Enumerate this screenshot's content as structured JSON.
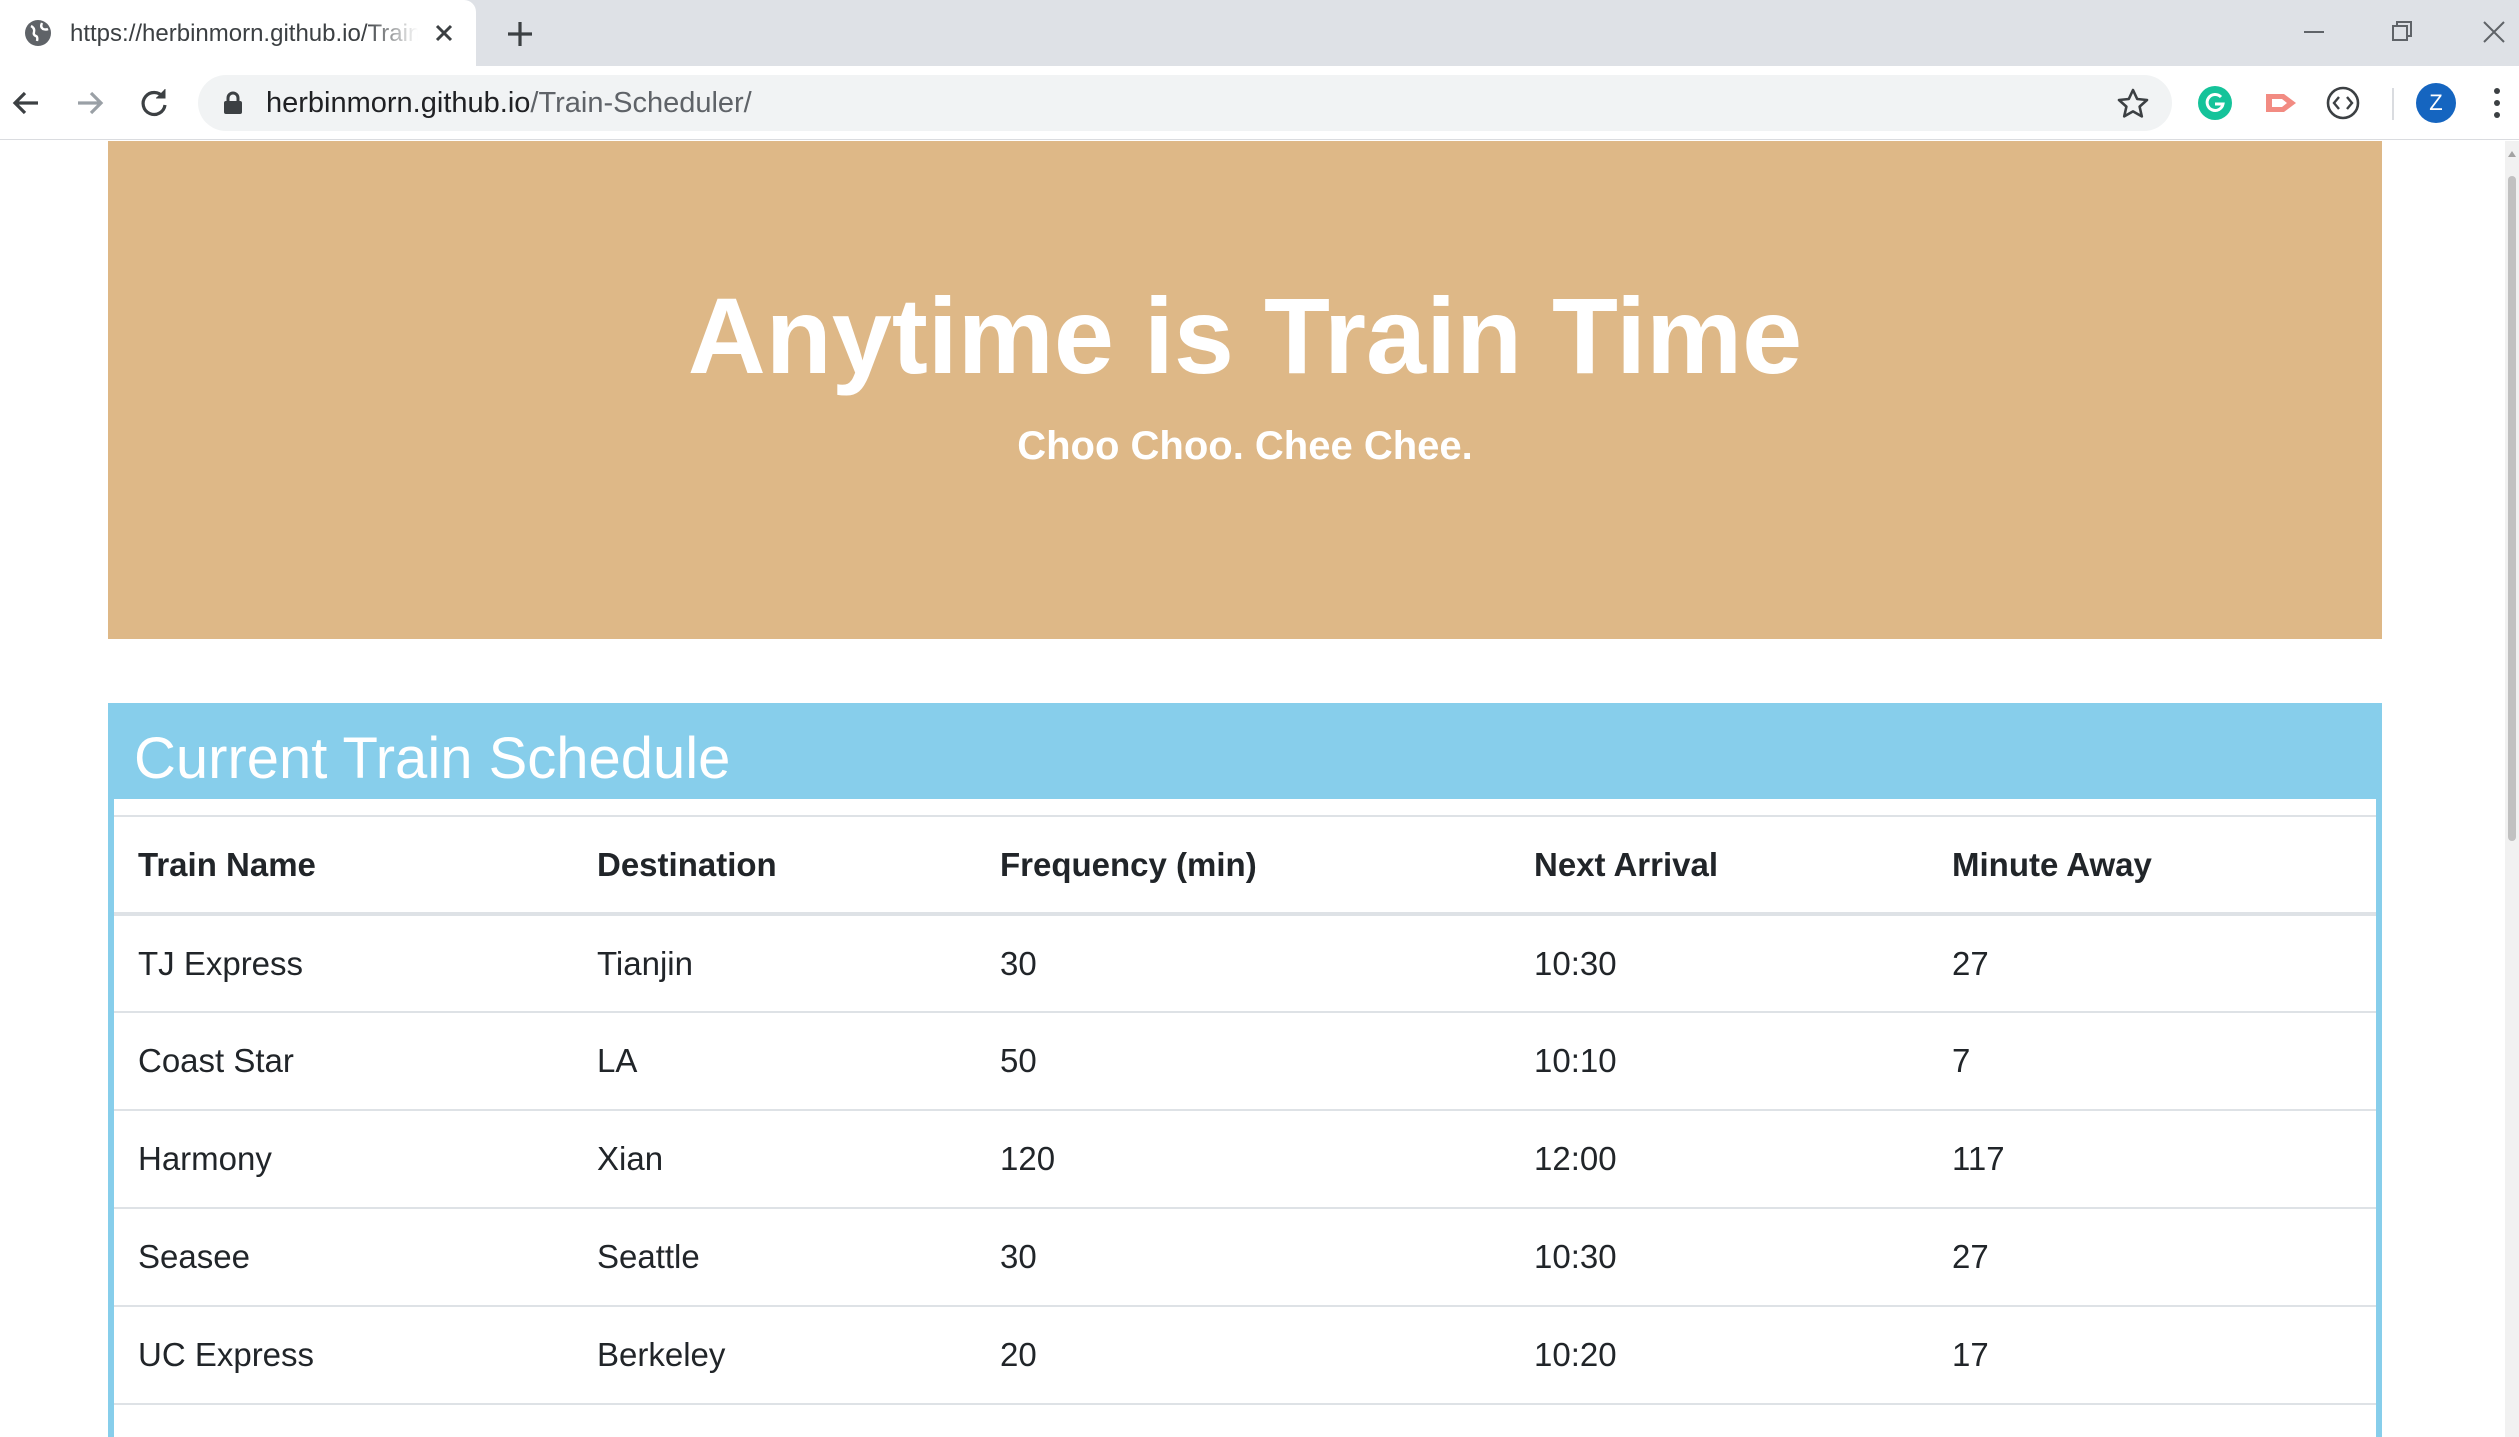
{
  "browser": {
    "tab_title": "https://herbinmorn.github.io/Train-Scheduler/",
    "url_host": "herbinmorn.github.io",
    "url_path": "/Train-Scheduler/",
    "profile_initial": "Z"
  },
  "jumbotron": {
    "title": "Anytime is Train Time",
    "subtitle": "Choo Choo. Chee Chee."
  },
  "schedule": {
    "heading": "Current Train Schedule",
    "columns": [
      "Train Name",
      "Destination",
      "Frequency (min)",
      "Next Arrival",
      "Minute Away"
    ],
    "rows": [
      [
        "TJ Express",
        "Tianjin",
        "30",
        "10:30",
        "27"
      ],
      [
        "Coast Star",
        "LA",
        "50",
        "10:10",
        "7"
      ],
      [
        "Harmony",
        "Xian",
        "120",
        "12:00",
        "117"
      ],
      [
        "Seasee",
        "Seattle",
        "30",
        "10:30",
        "27"
      ],
      [
        "UC Express",
        "Berkeley",
        "20",
        "10:20",
        "17"
      ]
    ]
  },
  "colors": {
    "jumbotron_bg": "#deb887",
    "panel_accent": "#87ceeb",
    "grammarly_green": "#15c39a",
    "avatar_blue": "#1565c0"
  }
}
